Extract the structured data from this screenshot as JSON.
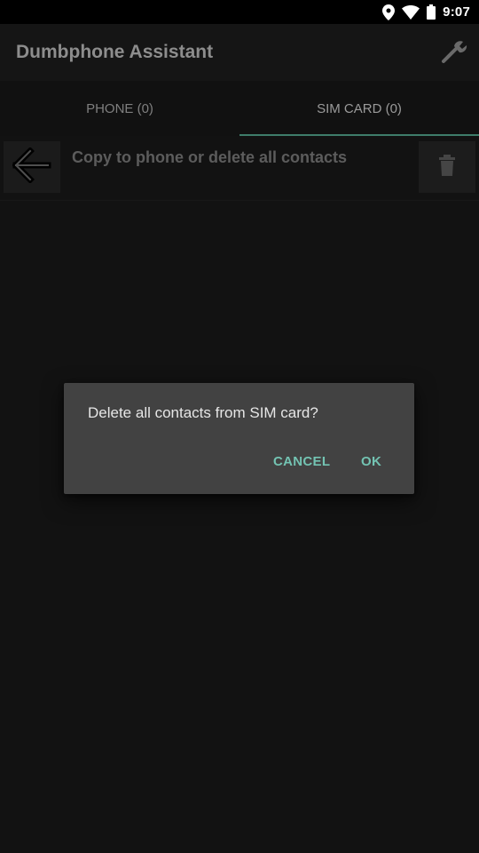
{
  "status_bar": {
    "time": "9:07",
    "icons": [
      "location-icon",
      "wifi-icon",
      "battery-icon"
    ]
  },
  "app_bar": {
    "title": "Dumbphone Assistant",
    "settings_icon": "wrench-icon"
  },
  "tabs": [
    {
      "label": "PHONE (0)",
      "active": false
    },
    {
      "label": "SIM CARD (0)",
      "active": true
    }
  ],
  "action_row": {
    "text": "Copy to phone or delete all contacts",
    "left_icon": "arrow-left-icon",
    "right_icon": "trash-icon"
  },
  "dialog": {
    "message": "Delete all contacts from SIM card?",
    "cancel_label": "CANCEL",
    "ok_label": "OK"
  },
  "colors": {
    "accent": "#73c3b2",
    "tab_indicator": "#3e7d6a",
    "background": "#1c1c1c",
    "dialog_bg": "#424242"
  }
}
